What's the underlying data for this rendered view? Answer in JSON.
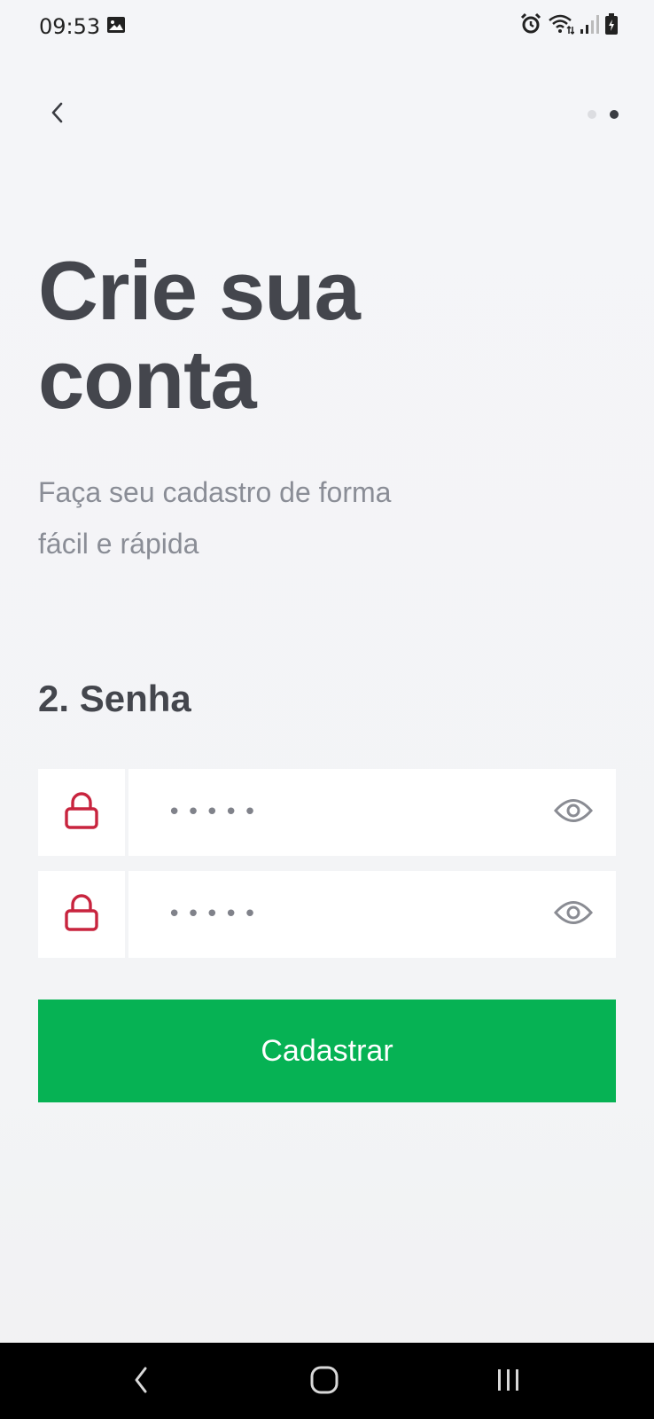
{
  "status_bar": {
    "time": "09:53",
    "icons": [
      "gallery-icon",
      "alarm-icon",
      "wifi-icon",
      "signal-icon",
      "battery-icon"
    ]
  },
  "nav": {
    "back_icon": "chevron-left-icon",
    "steps_total": 2,
    "current_step": 2
  },
  "header": {
    "title": "Crie sua conta",
    "subtitle": "Faça seu cadastro de forma fácil e rápida"
  },
  "section": {
    "heading": "2. Senha"
  },
  "fields": [
    {
      "icon": "lock-icon",
      "value": "•••••",
      "toggle_icon": "eye-icon"
    },
    {
      "icon": "lock-icon",
      "value": "•••••",
      "toggle_icon": "eye-icon"
    }
  ],
  "submit": {
    "label": "Cadastrar"
  },
  "system_nav": {
    "icons": [
      "back-icon",
      "home-icon",
      "recents-icon"
    ]
  },
  "colors": {
    "accent_green": "#06b254",
    "lock_red": "#c8243e",
    "text_dark": "#44464d",
    "text_muted": "#8a8d96",
    "background": "#f4f5f8"
  }
}
